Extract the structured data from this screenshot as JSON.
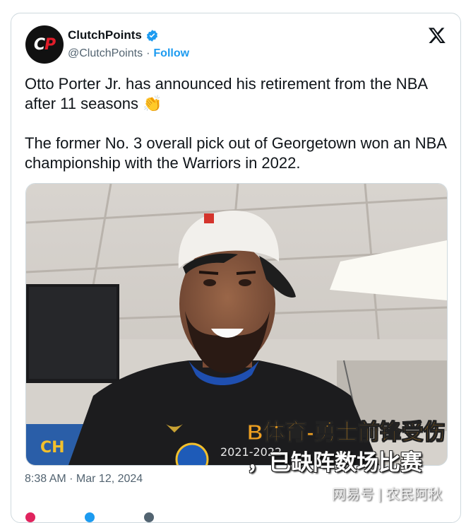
{
  "account": {
    "name": "ClutchPoints",
    "handle": "@ClutchPoints",
    "follow_label": "Follow",
    "avatar_text_white": "C",
    "avatar_text_red": "P"
  },
  "tweet": {
    "line1": "Otto Porter Jr. has announced his retirement from the NBA after 11 seasons",
    "emoji": "👏",
    "line2": "The former No. 3 overall pick out of Georgetown won an NBA championship with the Warriors in 2022.",
    "timestamp": "8:38 AM · Mar 12, 2024"
  },
  "media": {
    "jersey_text": "2021-2022",
    "banner_text": "CH"
  },
  "overlay": {
    "headline_line1": "B体育-勇士前锋受伤",
    "headline_line2": "，已缺阵数场比赛",
    "source": "网易号 | 农民阿秋"
  },
  "colors": {
    "accent": "#1d9bf0",
    "text": "#0f1419",
    "muted": "#536471",
    "brand_red": "#e11d2a"
  }
}
